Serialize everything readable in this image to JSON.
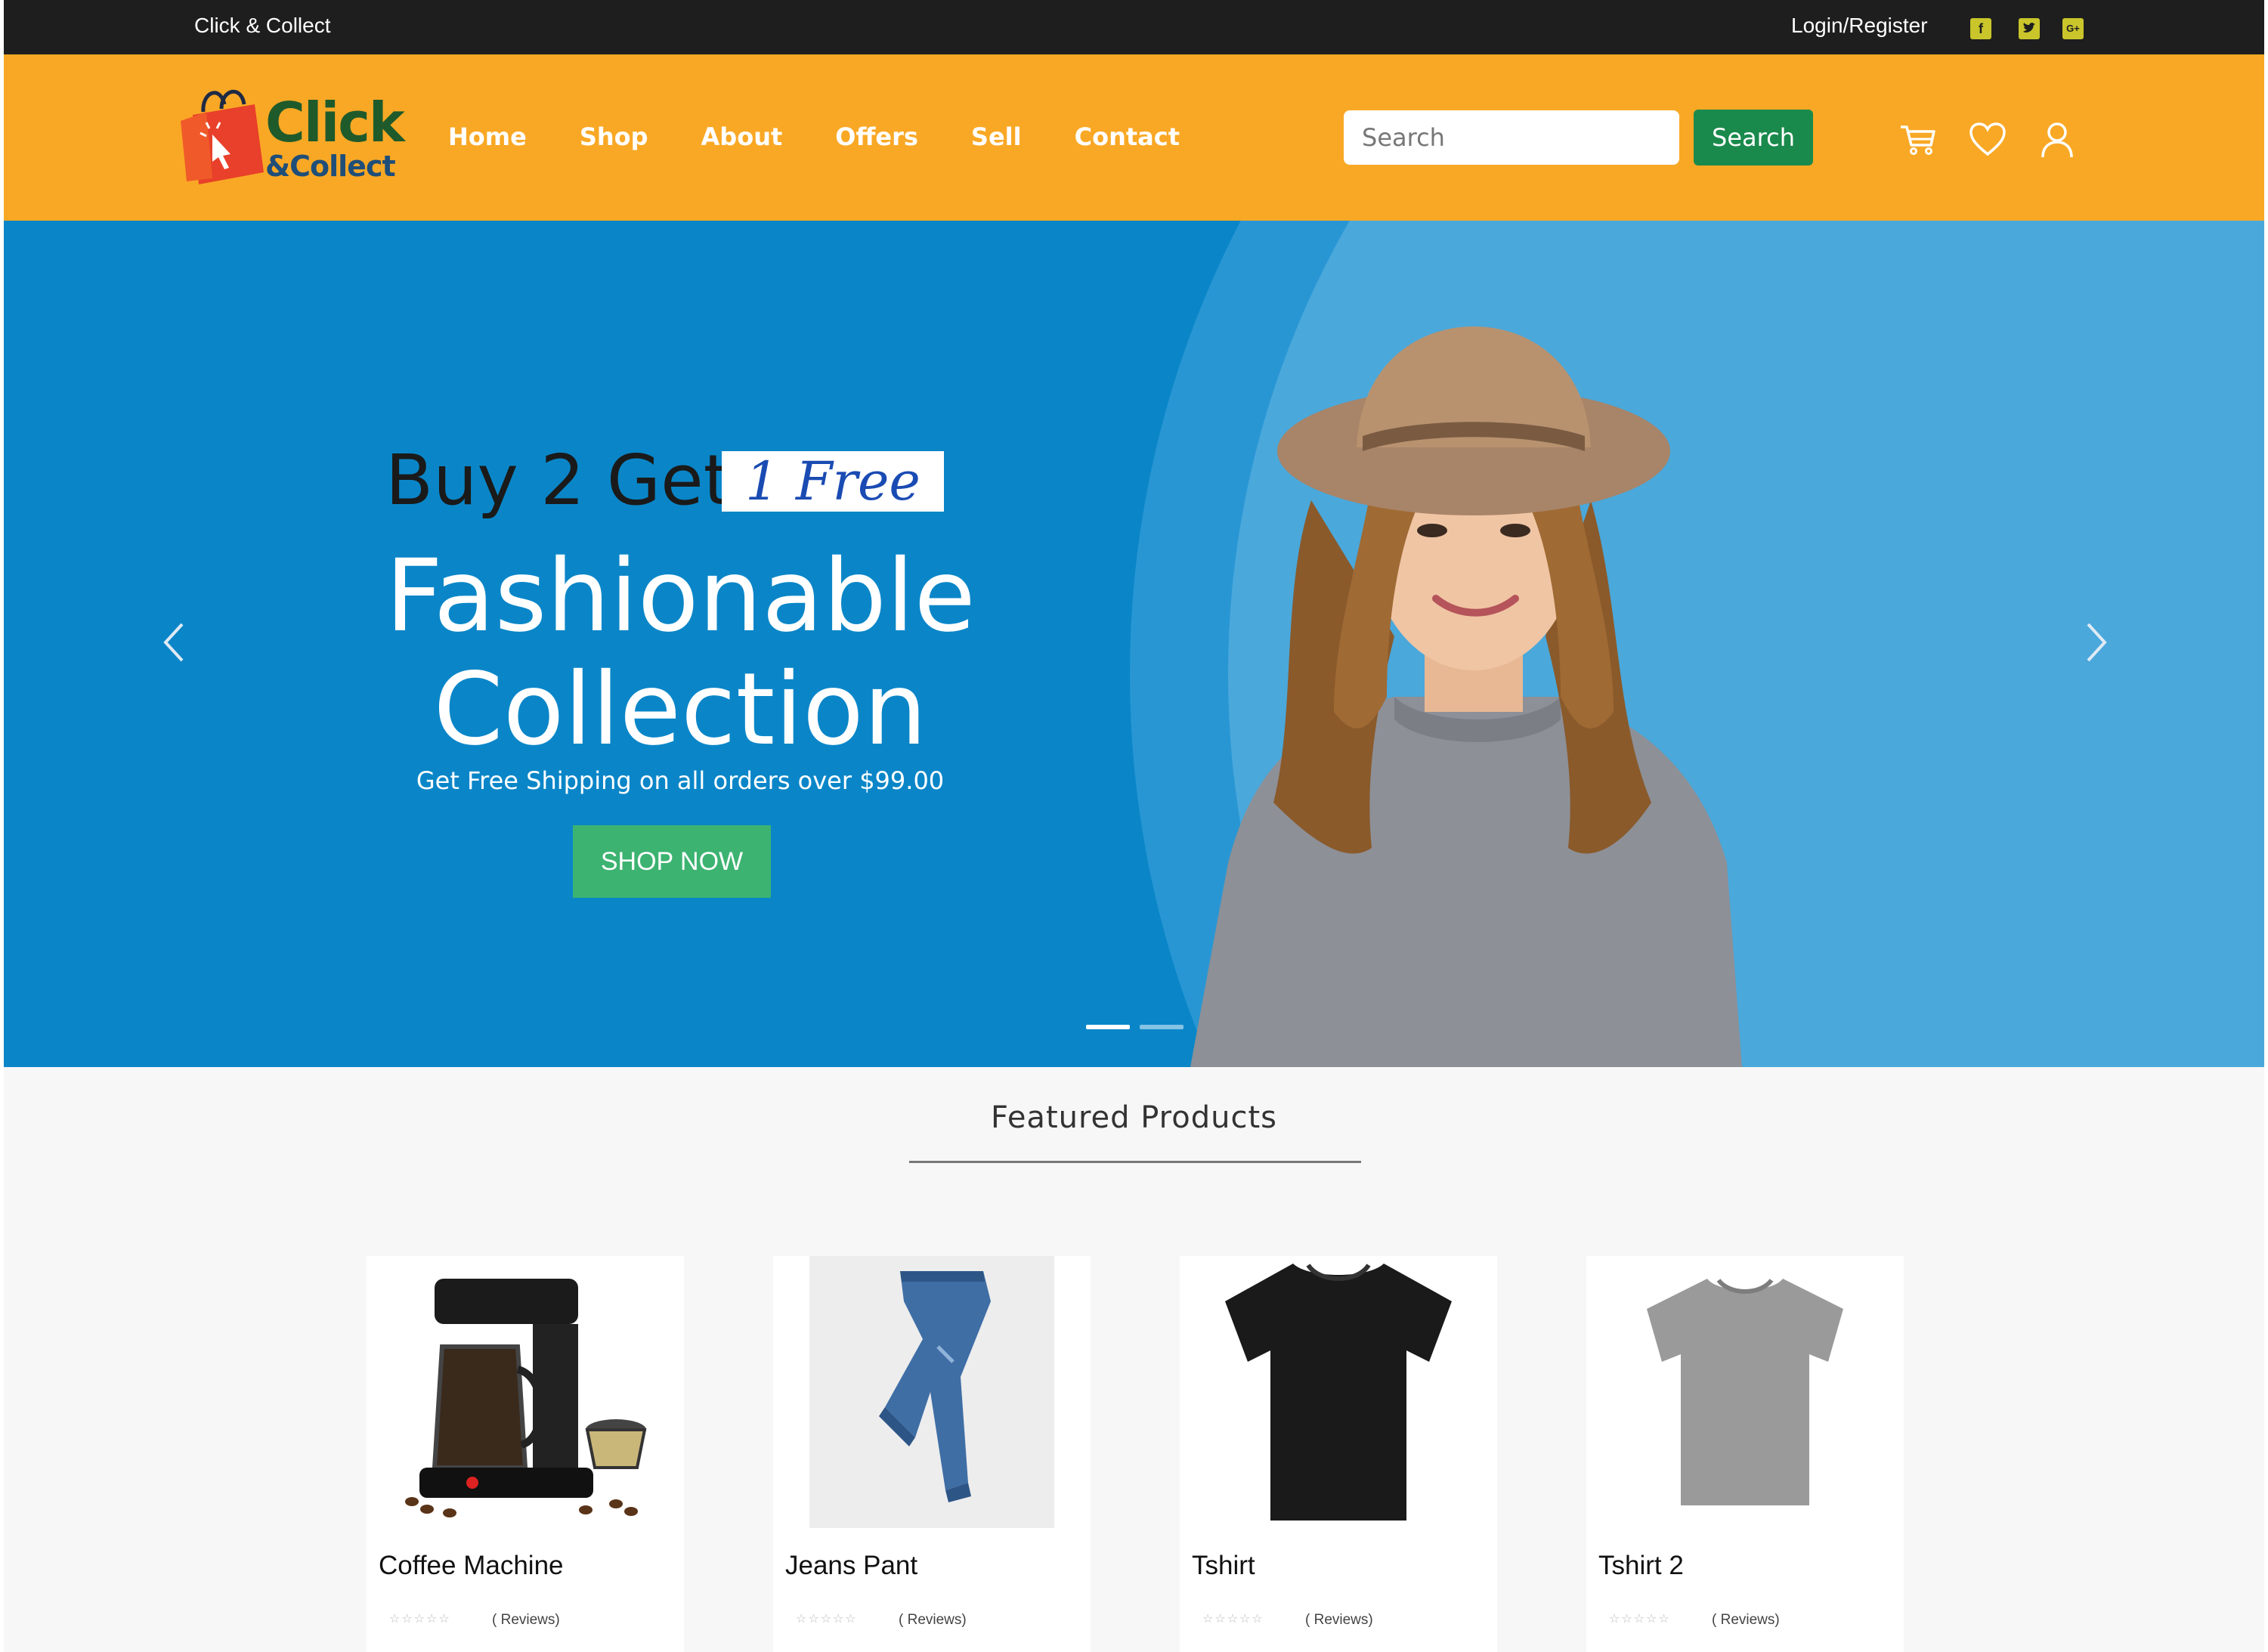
{
  "topbar": {
    "brand_text": "Click & Collect",
    "login_label": "Login/Register",
    "social": {
      "facebook": "f",
      "twitter": "t",
      "google_plus": "G+"
    }
  },
  "header": {
    "logo": {
      "line1": "Click",
      "line2": "&Collect"
    },
    "nav": [
      {
        "label": "Home"
      },
      {
        "label": "Shop"
      },
      {
        "label": "About"
      },
      {
        "label": "Offers"
      },
      {
        "label": "Sell"
      },
      {
        "label": "Contact"
      }
    ],
    "search": {
      "placeholder": "Search",
      "button_label": "Search"
    },
    "icons": [
      "cart-icon",
      "heart-icon",
      "user-icon"
    ]
  },
  "hero": {
    "promo_prefix": "Buy 2 Get",
    "promo_highlight": "1 Free",
    "title_line1": "Fashionable",
    "title_line2": "Collection",
    "subtitle": "Get Free Shipping on all orders over $99.00",
    "cta_label": "SHOP NOW",
    "active_slide": 1,
    "slide_count": 2
  },
  "featured": {
    "title": "Featured Products",
    "products": [
      {
        "name": "Coffee Machine",
        "stars": "☆☆☆☆☆",
        "reviews": "( Reviews)"
      },
      {
        "name": "Jeans Pant",
        "stars": "☆☆☆☆☆",
        "reviews": "( Reviews)"
      },
      {
        "name": "Tshirt",
        "stars": "☆☆☆☆☆",
        "reviews": "( Reviews)"
      },
      {
        "name": "Tshirt 2",
        "stars": "☆☆☆☆☆",
        "reviews": "( Reviews)"
      }
    ]
  },
  "colors": {
    "topbar": "#1e1e1e",
    "header": "#f9a825",
    "hero": "#0a86c8",
    "search_button": "#1a8a4c",
    "cta": "#3cb371"
  }
}
